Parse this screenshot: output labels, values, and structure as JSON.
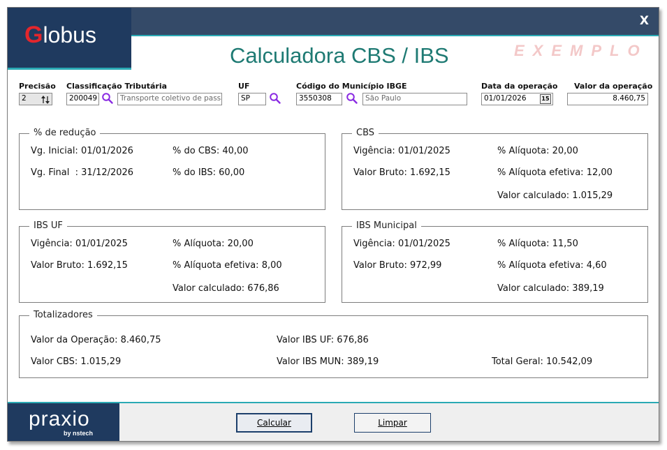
{
  "header": {
    "logo": "Globus",
    "close": "X",
    "title": "Calculadora CBS / IBS",
    "watermark": "EXEMPLO"
  },
  "form": {
    "precisao": {
      "label": "Precisão",
      "value": "2"
    },
    "classificacao": {
      "label": "Classificação Tributária",
      "code": "200049",
      "description": "Transporte coletivo de passage"
    },
    "uf": {
      "label": "UF",
      "value": "SP"
    },
    "municipio": {
      "label": "Código do Município IBGE",
      "code": "3550308",
      "name": "São Paulo"
    },
    "data_operacao": {
      "label": "Data da operação",
      "value": "01/01/2026",
      "calendar": "15"
    },
    "valor_operacao": {
      "label": "Valor da operação",
      "value": "8.460,75"
    }
  },
  "reducao": {
    "title": "% de redução",
    "vg_inicial": "Vg. Inicial: 01/01/2026",
    "vg_final": "Vg. Final  : 31/12/2026",
    "cbs": "% do CBS: 40,00",
    "ibs": "% do IBS: 60,00"
  },
  "cbs": {
    "title": "CBS",
    "vigencia": "Vigência: 01/01/2025",
    "valor_bruto": "Valor Bruto: 1.692,15",
    "aliquota": "% Alíquota: 20,00",
    "aliquota_efetiva": "% Alíquota efetiva: 12,00",
    "valor_calculado": "Valor calculado: 1.015,29"
  },
  "ibs_uf": {
    "title": "IBS UF",
    "vigencia": "Vigência: 01/01/2025",
    "valor_bruto": "Valor Bruto: 1.692,15",
    "aliquota": "% Alíquota: 20,00",
    "aliquota_efetiva": "% Alíquota efetiva: 8,00",
    "valor_calculado": "Valor calculado: 676,86"
  },
  "ibs_mun": {
    "title": "IBS Municipal",
    "vigencia": "Vigência: 01/01/2025",
    "valor_bruto": "Valor Bruto: 972,99",
    "aliquota": "% Alíquota: 11,50",
    "aliquota_efetiva": "% Alíquota efetiva: 4,60",
    "valor_calculado": "Valor calculado: 389,19"
  },
  "totalizadores": {
    "title": "Totalizadores",
    "valor_operacao": "Valor da Operação: 8.460,75",
    "valor_cbs": "Valor CBS: 1.015,29",
    "valor_ibs_uf": "Valor IBS UF: 676,86",
    "valor_ibs_mun": "Valor IBS MUN: 389,19",
    "total_geral": "Total Geral: 10.542,09"
  },
  "footer": {
    "brand": "praxio",
    "brand_sub": "by nstech",
    "calcular": "Calcular",
    "limpar": "Limpar"
  },
  "colors": {
    "header_bg": "#344a68",
    "logo_bg": "#1f3a5f",
    "accent_teal": "#2aa9b4",
    "title_green": "#1e7a73",
    "logo_red": "#e3262c",
    "search_purple": "#8a2be2"
  }
}
